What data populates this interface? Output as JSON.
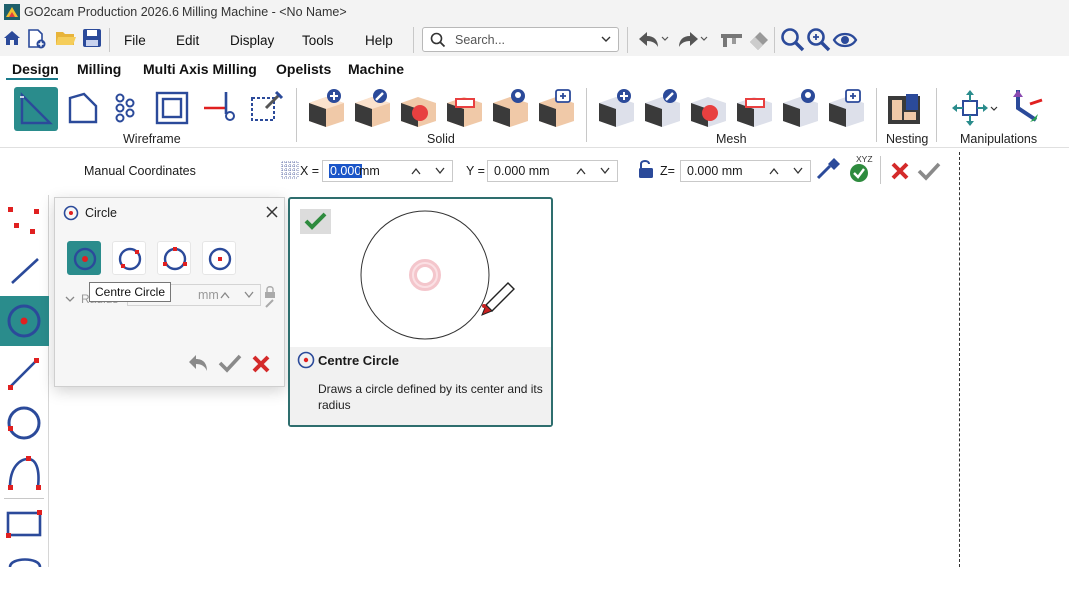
{
  "titlebar": {
    "app": "GO2cam Production 2026.6",
    "document": "Milling Machine - <No Name>"
  },
  "menu": {
    "items": [
      "File",
      "Edit",
      "Display",
      "Tools",
      "Help"
    ],
    "search_placeholder": "Search..."
  },
  "tabs": [
    "Design",
    "Milling",
    "Multi Axis Milling",
    "Opelists",
    "Machine"
  ],
  "active_tab": "Design",
  "ribbon": {
    "groups": [
      "Wireframe",
      "Solid",
      "Mesh",
      "Nesting",
      "Manipulations"
    ]
  },
  "coordbar": {
    "title": "Manual Coordinates",
    "x_label": "X =",
    "x_value": "0.000",
    "x_unit": "mm",
    "y_label": "Y =",
    "y_value": "0.000 mm",
    "z_label": "Z=",
    "z_value": "0.000 mm",
    "xyz_badge": "XYZ"
  },
  "circle_panel": {
    "title": "Circle",
    "radius_label": "Radius",
    "radius_unit": "mm",
    "tooltip": "Centre Circle"
  },
  "preview": {
    "title": "Centre Circle",
    "description": "Draws a circle defined by its center and its radius"
  },
  "colors": {
    "accent": "#2e6e6e",
    "active_tool": "#2a8c8c",
    "icon_blue": "#3b4f9a",
    "icon_red": "#e02020",
    "ok_green": "#2e8b3e"
  }
}
